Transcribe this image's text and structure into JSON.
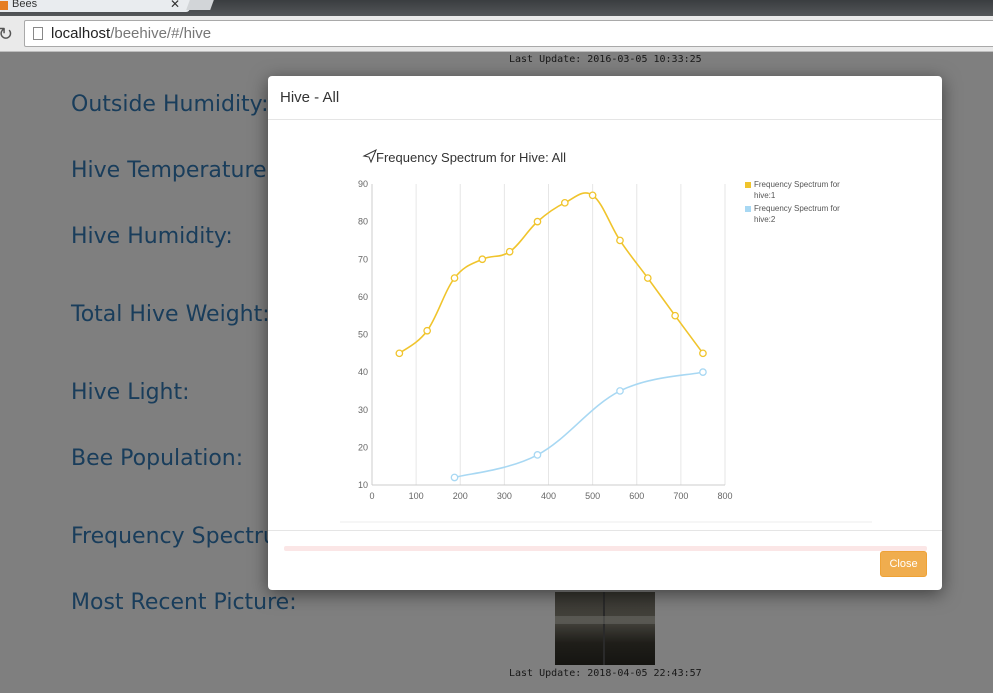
{
  "browser": {
    "tab_title": "Bees",
    "tab_close": "✕",
    "url_host": "localhost",
    "url_path": "/beehive/#/hive",
    "reload_icon": "reload-icon"
  },
  "page": {
    "top_last_update": "Last Update: 2016-03-05 10:33:25",
    "bottom_last_update": "Last Update: 2018-04-05 22:43:57",
    "labels": [
      "Outside Humidity:",
      "Hive Temperature:",
      "Hive Humidity:",
      "Total Hive Weight:",
      "Hive Light:",
      "Bee Population:",
      "Frequency Spectrum",
      "Most Recent Picture:"
    ]
  },
  "modal": {
    "title": "Hive - All",
    "close_label": "Close",
    "colors": {
      "accent": "#f0ad4e"
    }
  },
  "chart_data": {
    "type": "line",
    "title": "Frequency Spectrum for Hive: All",
    "title_icon": "send-icon",
    "xlim": [
      0,
      800
    ],
    "ylim": [
      10,
      90
    ],
    "xticks": [
      0,
      100,
      200,
      300,
      400,
      500,
      600,
      700,
      800
    ],
    "yticks": [
      10,
      20,
      30,
      40,
      50,
      60,
      70,
      80,
      90
    ],
    "grid": "vertical",
    "legend_position": "top-right",
    "series": [
      {
        "name": "Frequency Spectrum for hive:1",
        "color": "#f0c42c",
        "x": [
          62,
          125,
          187,
          250,
          312,
          375,
          437,
          500,
          562,
          625,
          687,
          750
        ],
        "y": [
          45,
          51,
          65,
          70,
          72,
          80,
          85,
          87,
          75,
          65,
          55,
          45
        ]
      },
      {
        "name": "Frequency Spectrum for hive:2",
        "color": "#a8d8f3",
        "x": [
          187,
          375,
          562,
          750
        ],
        "y": [
          12,
          18,
          35,
          40
        ]
      }
    ]
  }
}
